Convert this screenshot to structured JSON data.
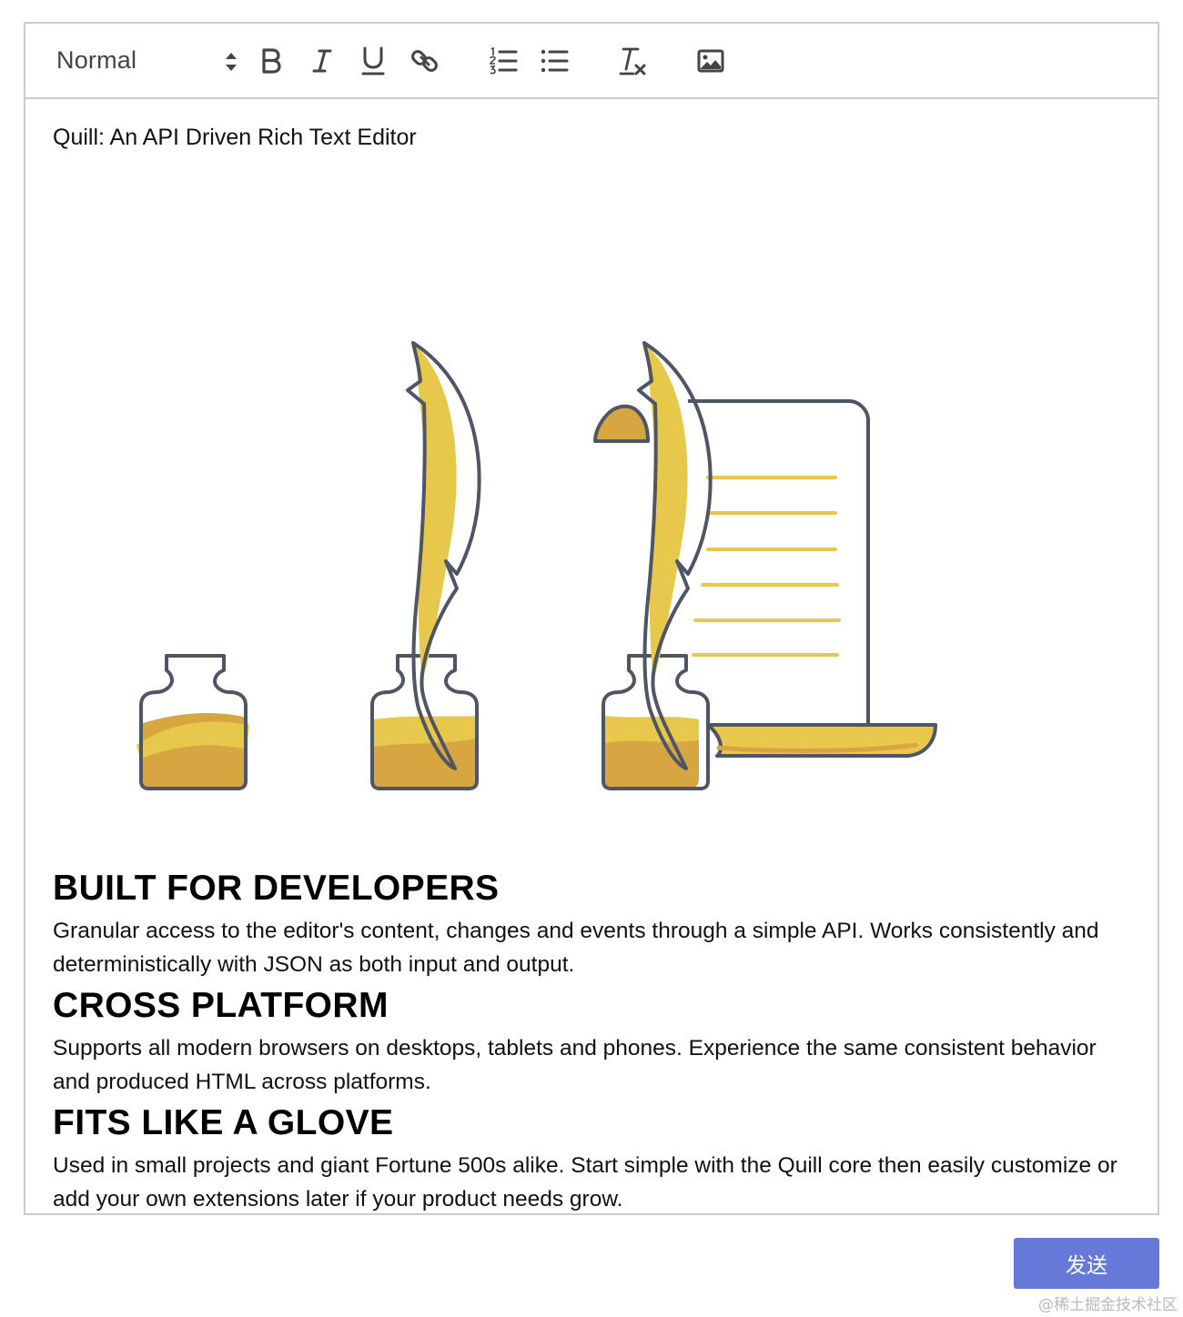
{
  "toolbar": {
    "header_value": "Normal",
    "buttons": [
      {
        "name": "bold-icon",
        "label": "B"
      },
      {
        "name": "italic-icon",
        "label": "I"
      },
      {
        "name": "underline-icon",
        "label": "U"
      },
      {
        "name": "link-icon",
        "label": ""
      },
      {
        "name": "ordered-list-icon",
        "label": ""
      },
      {
        "name": "bullet-list-icon",
        "label": ""
      },
      {
        "name": "clear-format-icon",
        "label": ""
      },
      {
        "name": "image-icon",
        "label": ""
      }
    ]
  },
  "editor": {
    "first_line": "Quill: An API Driven Rich Text Editor",
    "sections": [
      {
        "title": "BUILT FOR DEVELOPERS",
        "body": "Granular access to the editor's content, changes and events through a simple API. Works consistently and deterministically with JSON as both input and output."
      },
      {
        "title": "CROSS PLATFORM",
        "body": "Supports all modern browsers on desktops, tablets and phones. Experience the same consistent behavior and produced HTML across platforms."
      },
      {
        "title": "FITS LIKE A GLOVE",
        "body": "Used in small projects and giant Fortune 500s alike. Start simple with the Quill core then easily customize or add your own extensions later if your product needs grow."
      }
    ]
  },
  "send_button_label": "发送",
  "watermark": "@稀土掘金技术社区",
  "colors": {
    "accent": "#6679d8",
    "ink_yellow": "#e8c84a",
    "ink_amber": "#d8a640",
    "outline": "#4e5564",
    "border": "#cccccc"
  }
}
